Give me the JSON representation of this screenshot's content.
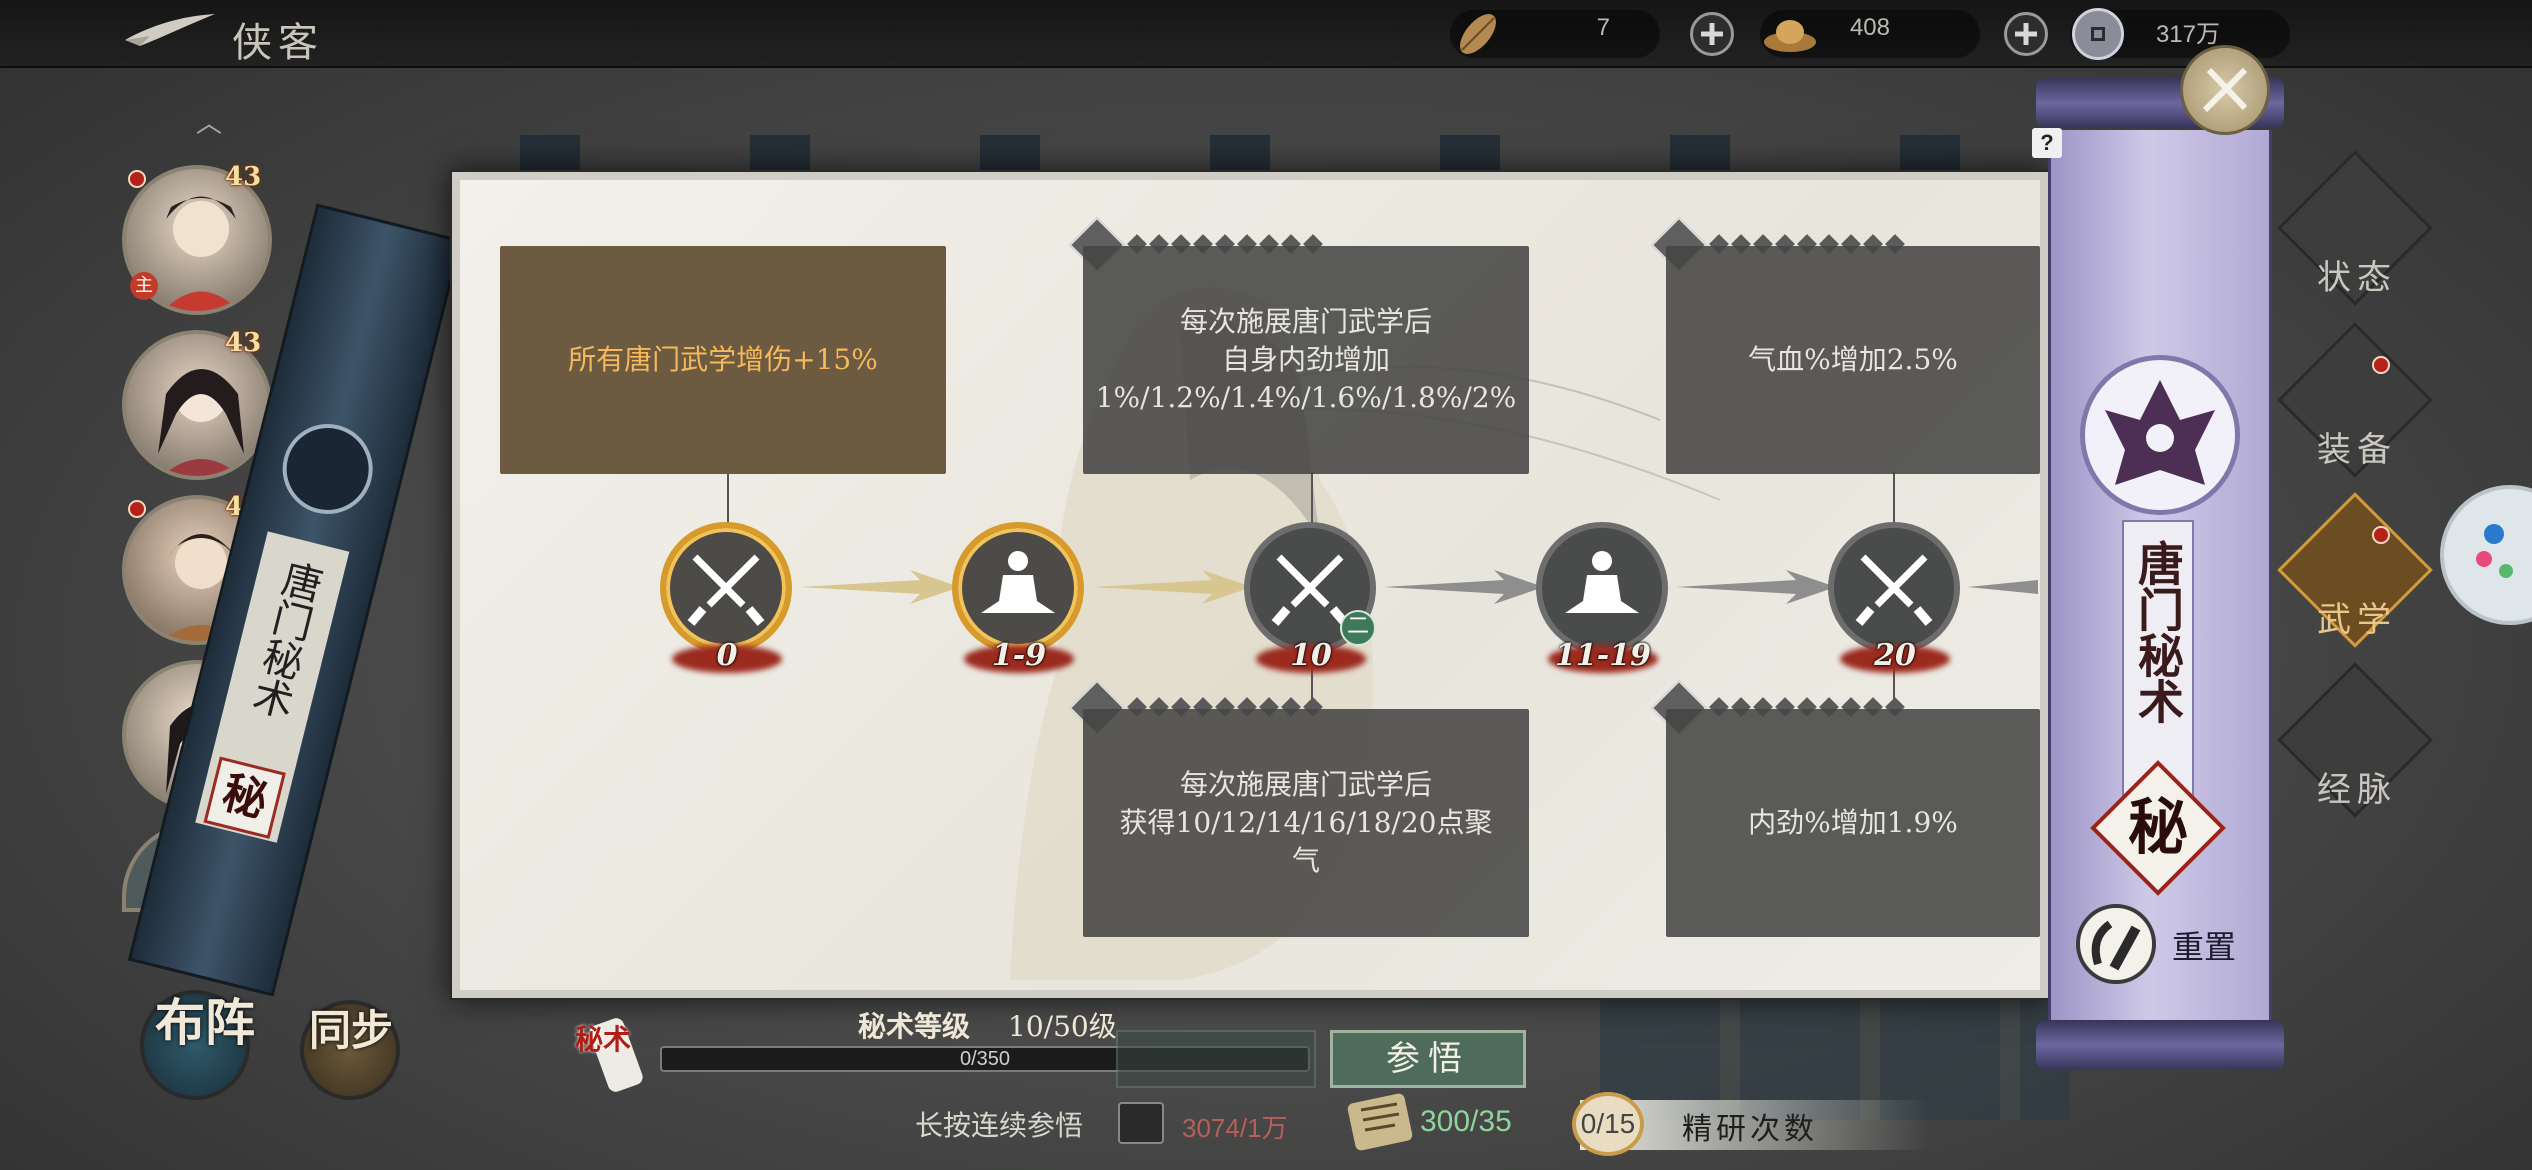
{
  "header": {
    "title": "侠客",
    "resources": [
      {
        "name": "leaf-currency",
        "value": "7"
      },
      {
        "name": "ingot-currency",
        "value": "408"
      },
      {
        "name": "coin-currency",
        "value": "317万"
      }
    ]
  },
  "heroes": [
    {
      "level": "43",
      "tag": "主"
    },
    {
      "level": "43"
    },
    {
      "level": "43"
    },
    {
      "level": ""
    }
  ],
  "left_scroll": {
    "text": "唐门秘术",
    "seal": "秘"
  },
  "left_buttons": {
    "formation": "布阵",
    "sync": "同步"
  },
  "tree": {
    "cards": {
      "root": "所有唐门武学增伤+15%",
      "top1": "每次施展唐门武学后\n自身内劲增加\n1%/1.2%/1.4%/1.6%/1.8%/2%",
      "top2": "气血%增加2.5%",
      "bottom1": "每次施展唐门武学后\n获得10/12/14/16/18/20点聚\n气",
      "bottom2": "内劲%增加1.9%"
    },
    "nodes": [
      {
        "label": "0",
        "icon": "daggers-icon",
        "active": true
      },
      {
        "label": "1-9",
        "icon": "meditate-icon",
        "active": true
      },
      {
        "label": "10",
        "icon": "daggers-icon",
        "active": false
      },
      {
        "label": "11-19",
        "icon": "meditate-icon",
        "active": false
      },
      {
        "label": "20",
        "icon": "daggers-icon",
        "active": false
      }
    ]
  },
  "right_scroll": {
    "title": "唐门秘术",
    "seal": "秘",
    "reset_label": "重置"
  },
  "right_tabs": [
    "状态",
    "装备",
    "武学",
    "经脉"
  ],
  "bottom": {
    "secret_tag": "秘术",
    "mastery_label": "秘术等级",
    "mastery_value": "10/50级",
    "progress_text": "0/350",
    "progress": 0,
    "comprehend_button": "参悟",
    "long_press": "长按连续参悟",
    "resource_a": "3074/1万",
    "resource_b": "300/35",
    "study_count": "0/15",
    "study_label": "精研次数"
  }
}
